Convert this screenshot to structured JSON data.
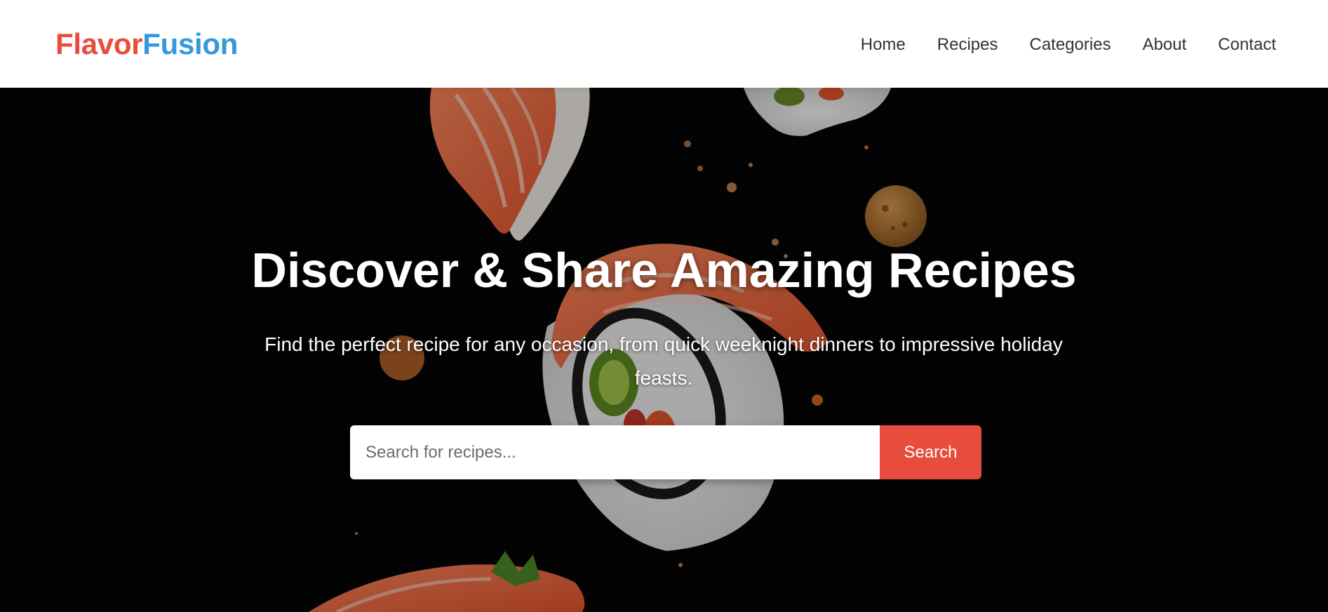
{
  "brand": {
    "name_part1": "Flavor",
    "name_part2": "Fusion",
    "color_part1": "#e74c3c",
    "color_part2": "#3498db"
  },
  "nav": {
    "items": [
      {
        "label": "Home"
      },
      {
        "label": "Recipes"
      },
      {
        "label": "Categories"
      },
      {
        "label": "About"
      },
      {
        "label": "Contact"
      }
    ]
  },
  "hero": {
    "title": "Discover & Share Amazing Recipes",
    "subtitle": "Find the perfect recipe for any occasion, from quick weeknight dinners to impressive holiday feasts.",
    "background": "sushi-photo",
    "search": {
      "placeholder": "Search for recipes...",
      "value": "",
      "button_label": "Search",
      "button_color": "#e74c3c"
    }
  }
}
